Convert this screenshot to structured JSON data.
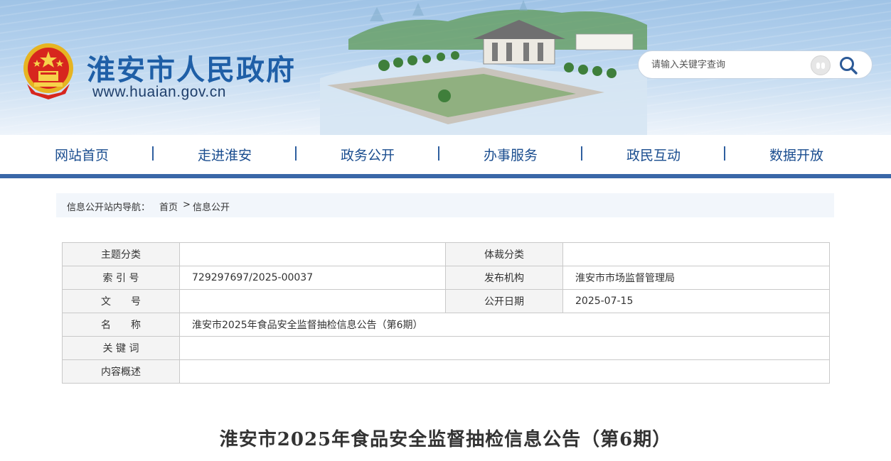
{
  "header": {
    "site_name": "淮安市人民政府",
    "site_domain": "www.huaian.gov.cn",
    "search_placeholder": "请输入关键字查询"
  },
  "nav": {
    "items": [
      "网站首页",
      "走进淮安",
      "政务公开",
      "办事服务",
      "政民互动",
      "数据开放"
    ],
    "separator": "|"
  },
  "breadcrumb": {
    "prefix": "信息公开站内导航：",
    "home": "首页",
    "sep": ">",
    "current": "信息公开"
  },
  "info_table": {
    "topic_label": "主题分类",
    "topic_value": "",
    "genre_label": "体裁分类",
    "genre_value": "",
    "index_label": "索 引 号",
    "index_value": "729297697/2025-00037",
    "publisher_label": "发布机构",
    "publisher_value": "淮安市市场监督管理局",
    "docno_label": "文　　号",
    "docno_value": "",
    "date_label": "公开日期",
    "date_value": "2025-07-15",
    "name_label": "名　　称",
    "name_value": "淮安市2025年食品安全监督抽检信息公告（第6期）",
    "keywords_label": "关 键 词",
    "keywords_value": "",
    "summary_label": "内容概述",
    "summary_value": ""
  },
  "article": {
    "title": "淮安市2025年食品安全监督抽检信息公告（第6期）"
  },
  "colors": {
    "brand_blue": "#1f5fa7",
    "nav_bar": "#3a67a8",
    "breadcrumb_bg": "#f2f6fb"
  },
  "icons": {
    "emblem": "national-emblem-icon",
    "voice": "voice-search-icon",
    "search": "magnifier-icon"
  }
}
